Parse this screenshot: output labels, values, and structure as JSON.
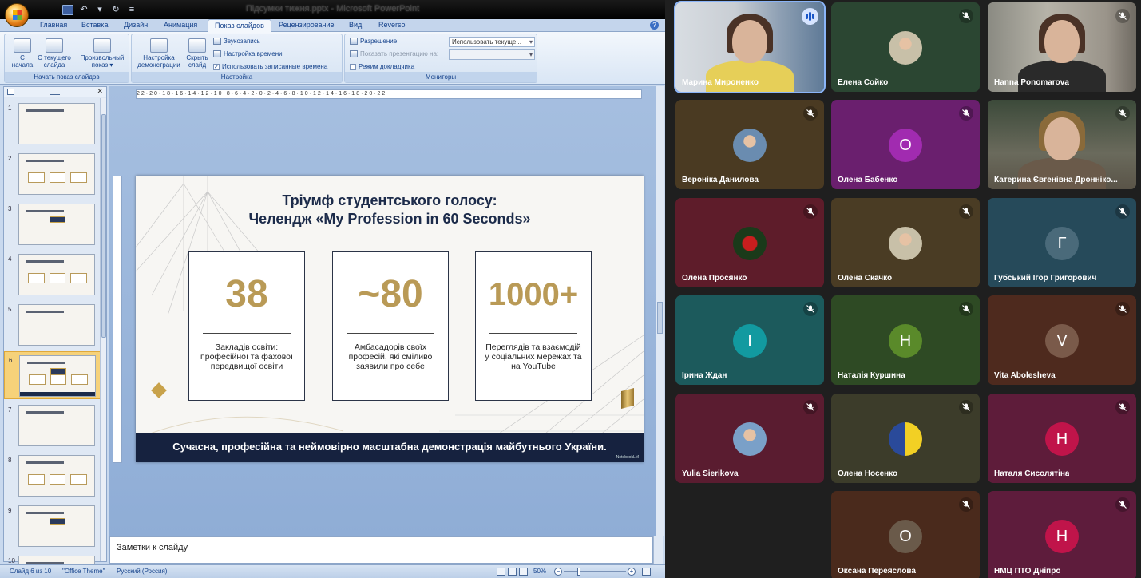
{
  "powerpoint": {
    "window_title": "Підсумки тижня.pptx - Microsoft PowerPoint",
    "tabs": [
      "Главная",
      "Вставка",
      "Дизайн",
      "Анимация",
      "Показ слайдов",
      "Рецензирование",
      "Вид",
      "Reverso"
    ],
    "active_tab": "Показ слайдов",
    "ribbon": {
      "group1_label": "Начать показ слайдов",
      "from_start": "С\nначала",
      "from_current": "С текущего\nслайда",
      "custom_show": "Произвольный\nпоказ ▾",
      "group2_label": "Настройка",
      "setup_show": "Настройка\nдемонстрации",
      "hide_slide": "Скрыть\nслайд",
      "record_narration": "Звукозапись",
      "rehearse_timings": "Настройка времени",
      "use_timings": "Использовать записанные времена",
      "group3_label": "Мониторы",
      "resolution_label": "Разрешение:",
      "resolution_value": "Использовать текуще...",
      "show_on_label": "Показать презентацию на:",
      "presenter_view": "Режим докладчика"
    },
    "ruler_text": "22·20·18·16·14·12·10·8·6·4·2·0·2·4·6·8·10·12·14·16·18·20·22",
    "thumbnails": [
      "1",
      "2",
      "3",
      "4",
      "5",
      "6",
      "7",
      "8",
      "9",
      "10"
    ],
    "selected_slide": 6,
    "notes_placeholder": "Заметки к слайду",
    "status": {
      "slide_info": "Слайд 6 из 10",
      "theme": "\"Office Theme\"",
      "language": "Русский (Россия)",
      "zoom": "50%"
    }
  },
  "slide": {
    "title_line1": "Тріумф студентського голосу:",
    "title_line2": "Челендж «My Profession in 60 Seconds»",
    "cards": [
      {
        "number": "38",
        "text": "Закладів освіти: професійної та фахової передвищої освіти"
      },
      {
        "number": "~80",
        "text": "Амбасадорів своїх професій, які сміливо заявили про себе"
      },
      {
        "number": "1000+",
        "text": "Переглядів та взаємодій у соціальних мережах та на YouTube"
      }
    ],
    "footer": "Сучасна, професійна та неймовірно масштабна демонстрація майбутнього України.",
    "watermark": "NotebookLM",
    "colors": {
      "navy": "#16223f",
      "gold": "#b99a56"
    }
  },
  "meeting": {
    "participants": [
      {
        "name": "Марина Мироненко",
        "type": "video",
        "speaking": true
      },
      {
        "name": "Елена Сойко",
        "type": "photo",
        "muted": true
      },
      {
        "name": "Hanna Ponomarova",
        "type": "video",
        "muted": true
      },
      {
        "name": "Вероніка Данилова",
        "type": "photo",
        "muted": true
      },
      {
        "name": "Олена Бабенко",
        "type": "letter",
        "letter": "О",
        "muted": true
      },
      {
        "name": "Катерина Євгенівна Дронніко...",
        "type": "video",
        "muted": true
      },
      {
        "name": "Олена Просянко",
        "type": "photo",
        "muted": true
      },
      {
        "name": "Олена Скачко",
        "type": "photo",
        "muted": true
      },
      {
        "name": "Губський Ігор Григорович",
        "type": "letter",
        "letter": "Г",
        "muted": true
      },
      {
        "name": "Ірина Ждан",
        "type": "letter",
        "letter": "І",
        "muted": true
      },
      {
        "name": "Наталія Куршина",
        "type": "letter",
        "letter": "Н",
        "muted": true
      },
      {
        "name": "Vita Abolesheva",
        "type": "letter",
        "letter": "V",
        "muted": true
      },
      {
        "name": "Yulia Sierikova",
        "type": "photo",
        "muted": true
      },
      {
        "name": "Олена Носенко",
        "type": "photo",
        "muted": true
      },
      {
        "name": "Наталя Сисолятіна",
        "type": "letter",
        "letter": "Н",
        "muted": true
      },
      {
        "name": "Оксана Переяслова",
        "type": "letter",
        "letter": "О",
        "muted": true
      },
      {
        "name": "НМЦ ПТО Дніпро",
        "type": "letter",
        "letter": "Н",
        "muted": true
      }
    ],
    "tile_colors": [
      "#4f6a86",
      "#2b4632",
      "#6f6458",
      "#4a3a22",
      "#6a1f6e",
      "#4a4a3e",
      "#5e1c2a",
      "#4a3c24",
      "#264a5a",
      "#1c5a5c",
      "#2e4a24",
      "#4e2a1e",
      "#5a1c30",
      "#3c3c2a",
      "#5e1c3a",
      "#4a2a1c",
      "#5e1c3c"
    ]
  }
}
